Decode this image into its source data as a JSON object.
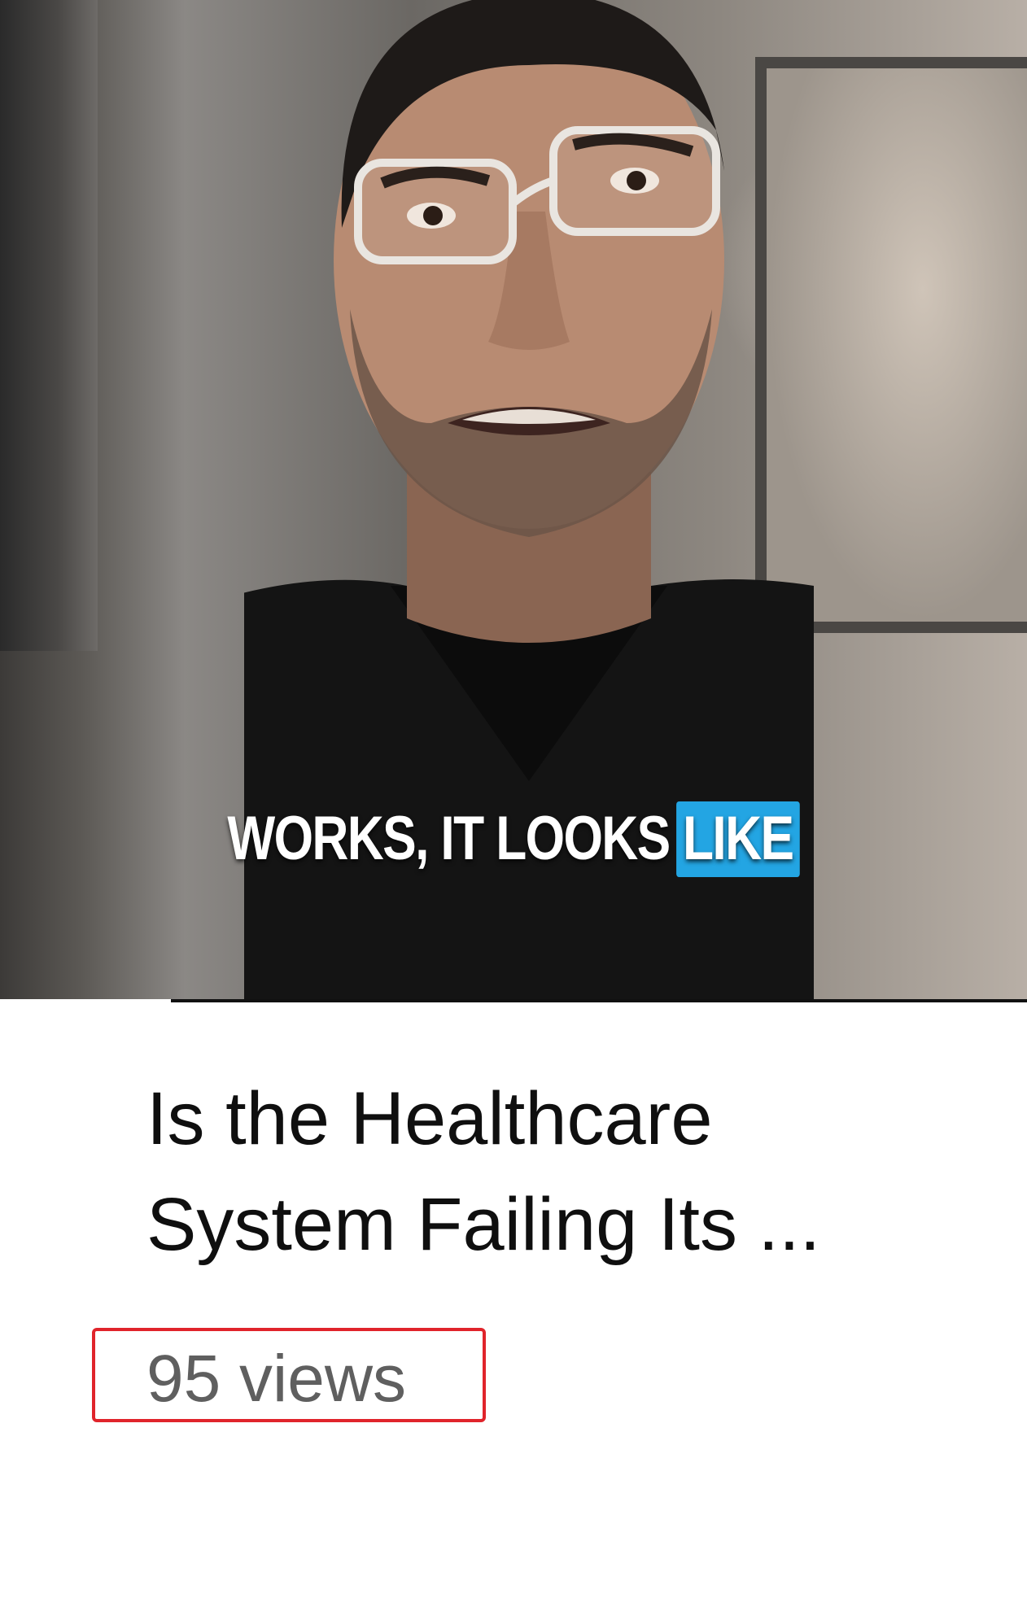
{
  "video": {
    "thumbnail_caption": {
      "main_text": "WORKS, IT LOOKS",
      "highlight_text": "LIKE",
      "highlight_color": "#23a5e3"
    },
    "title": "Is the Healthcare System Failing Its ...",
    "views": "95 views"
  },
  "colors": {
    "title_text": "#0f0f0f",
    "meta_text": "#5f5f5f",
    "highlight_border": "#e0242b"
  }
}
